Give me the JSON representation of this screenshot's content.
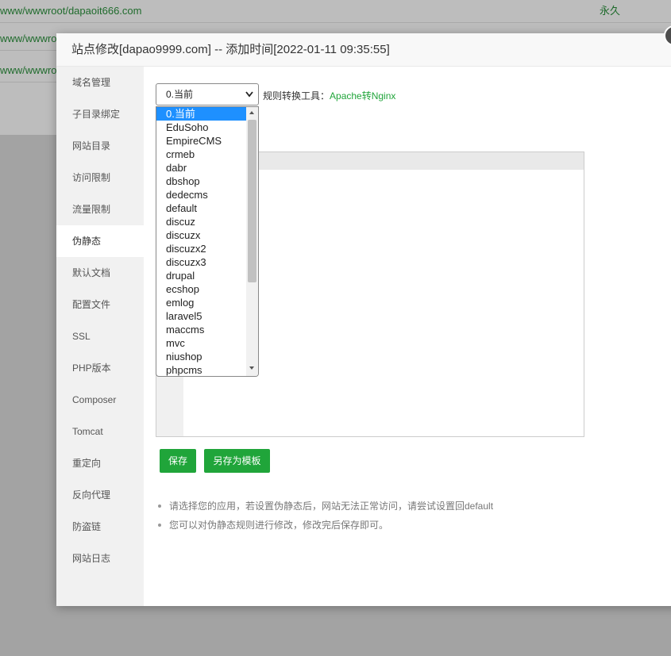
{
  "background": {
    "rows": [
      {
        "path": "www/wwwroot/dapaoit666.com",
        "expire": "永久"
      },
      {
        "path": "www/wwwro",
        "expire": ""
      },
      {
        "path": "www/wwwro",
        "expire": ""
      }
    ]
  },
  "modal": {
    "title": "站点修改[dapao9999.com] -- 添加时间[2022-01-11 09:35:55]",
    "close_glyph": "×"
  },
  "sidebar": {
    "items": [
      {
        "label": "域名管理",
        "active": false
      },
      {
        "label": "子目录绑定",
        "active": false
      },
      {
        "label": "网站目录",
        "active": false
      },
      {
        "label": "访问限制",
        "active": false
      },
      {
        "label": "流量限制",
        "active": false
      },
      {
        "label": "伪静态",
        "active": true
      },
      {
        "label": "默认文档",
        "active": false
      },
      {
        "label": "配置文件",
        "active": false
      },
      {
        "label": "SSL",
        "active": false
      },
      {
        "label": "PHP版本",
        "active": false
      },
      {
        "label": "Composer",
        "active": false
      },
      {
        "label": "Tomcat",
        "active": false
      },
      {
        "label": "重定向",
        "active": false
      },
      {
        "label": "反向代理",
        "active": false
      },
      {
        "label": "防盗链",
        "active": false
      },
      {
        "label": "网站日志",
        "active": false
      }
    ]
  },
  "rewrite": {
    "selected": "0.当前",
    "tool_label": "规则转换工具：",
    "tool_link": "Apache转Nginx",
    "options": [
      "0.当前",
      "EduSoho",
      "EmpireCMS",
      "crmeb",
      "dabr",
      "dbshop",
      "dedecms",
      "default",
      "discuz",
      "discuzx",
      "discuzx2",
      "discuzx3",
      "drupal",
      "ecshop",
      "emlog",
      "laravel5",
      "maccms",
      "mvc",
      "niushop",
      "phpcms"
    ],
    "save_label": "保存",
    "save_template_label": "另存为模板",
    "tips": [
      "请选择您的应用，若设置伪静态后，网站无法正常访问，请尝试设置回default",
      "您可以对伪静态规则进行修改，修改完后保存即可。"
    ]
  },
  "colors": {
    "accent": "#20a53a",
    "selection": "#1e90ff"
  }
}
